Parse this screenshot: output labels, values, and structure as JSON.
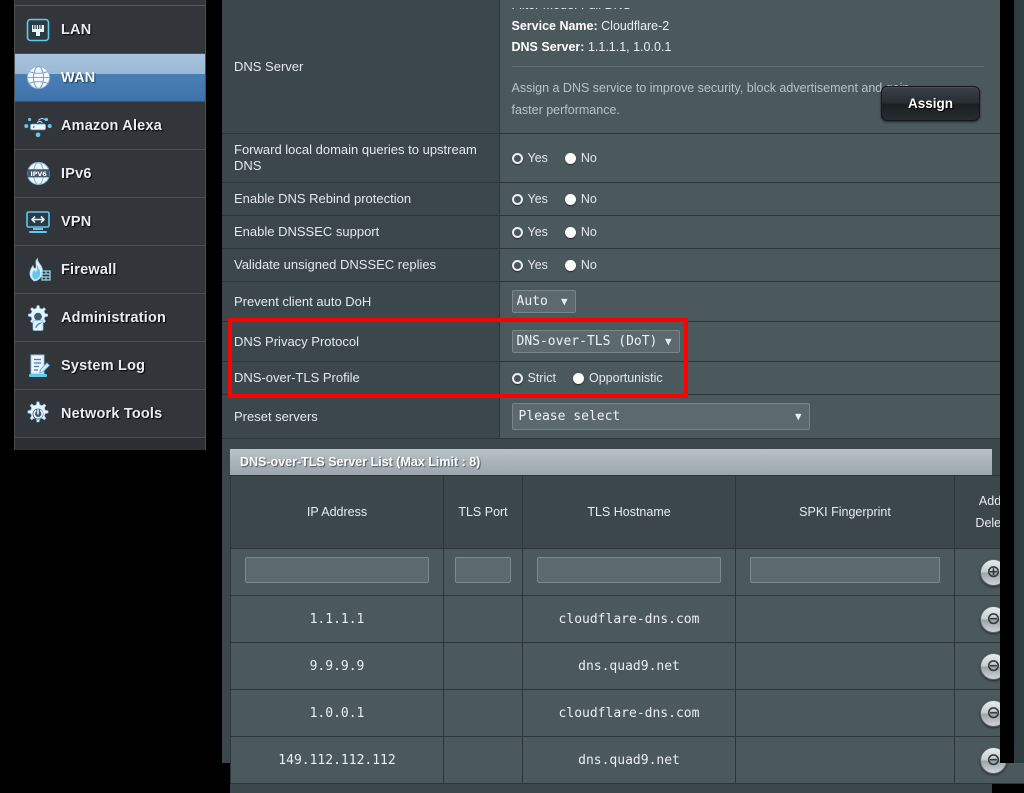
{
  "sidebar": {
    "items": [
      {
        "label": "LAN",
        "icon": "lan-icon",
        "active": false
      },
      {
        "label": "WAN",
        "icon": "globe-icon",
        "active": true
      },
      {
        "label": "Amazon Alexa",
        "icon": "alexa-icon",
        "active": false
      },
      {
        "label": "IPv6",
        "icon": "ipv6-icon",
        "active": false
      },
      {
        "label": "VPN",
        "icon": "vpn-icon",
        "active": false
      },
      {
        "label": "Firewall",
        "icon": "firewall-icon",
        "active": false
      },
      {
        "label": "Administration",
        "icon": "gear-pencil-icon",
        "active": false
      },
      {
        "label": "System Log",
        "icon": "system-log-icon",
        "active": false
      },
      {
        "label": "Network Tools",
        "icon": "network-tools-icon",
        "active": false
      }
    ]
  },
  "settings": {
    "dns_server": {
      "label": "DNS Server",
      "filter_mode_line": "Filter Mode: Full DNS",
      "service_name_key": "Service Name:",
      "service_name_value": "Cloudflare-2",
      "dns_server_key": "DNS Server:",
      "dns_server_value": "1.1.1.1, 1.0.0.1",
      "description": "Assign a DNS service to improve security, block advertisement and gain faster performance.",
      "assign_label": "Assign"
    },
    "rows": [
      {
        "label": "Forward local domain queries to upstream DNS",
        "yes": "Yes",
        "no": "No",
        "selected": "No"
      },
      {
        "label": "Enable DNS Rebind protection",
        "yes": "Yes",
        "no": "No",
        "selected": "No"
      },
      {
        "label": "Enable DNSSEC support",
        "yes": "Yes",
        "no": "No",
        "selected": "No"
      },
      {
        "label": "Validate unsigned DNSSEC replies",
        "yes": "Yes",
        "no": "No",
        "selected": "No"
      }
    ],
    "prevent_doh": {
      "label": "Prevent client auto DoH",
      "value": "Auto"
    },
    "privacy_protocol": {
      "label": "DNS Privacy Protocol",
      "value": "DNS-over-TLS (DoT)"
    },
    "dot_profile": {
      "label": "DNS-over-TLS Profile",
      "strict": "Strict",
      "opportunistic": "Opportunistic",
      "selected": "Opportunistic"
    },
    "preset_servers": {
      "label": "Preset servers",
      "value": "Please select"
    }
  },
  "server_list": {
    "title": "DNS-over-TLS Server List (Max Limit : 8)",
    "columns": [
      "IP Address",
      "TLS Port",
      "TLS Hostname",
      "SPKI Fingerprint"
    ],
    "action_column_line1": "Add /",
    "action_column_line2": "Delete",
    "add_glyph": "⊕",
    "delete_glyph": "⊖",
    "new_row": {
      "ip": "",
      "port": "",
      "hostname": "",
      "spki": ""
    },
    "rows": [
      {
        "ip": "1.1.1.1",
        "port": "",
        "hostname": "cloudflare-dns.com",
        "spki": ""
      },
      {
        "ip": "9.9.9.9",
        "port": "",
        "hostname": "dns.quad9.net",
        "spki": ""
      },
      {
        "ip": "1.0.0.1",
        "port": "",
        "hostname": "cloudflare-dns.com",
        "spki": ""
      },
      {
        "ip": "149.112.112.112",
        "port": "",
        "hostname": "dns.quad9.net",
        "spki": ""
      }
    ]
  },
  "colors": {
    "accent_blue": "#4a7fb5",
    "panel_bg": "#3b474b",
    "field_bg": "#4b585c",
    "highlight_red": "#fe0000",
    "icon_blue": "#63c8ef"
  }
}
